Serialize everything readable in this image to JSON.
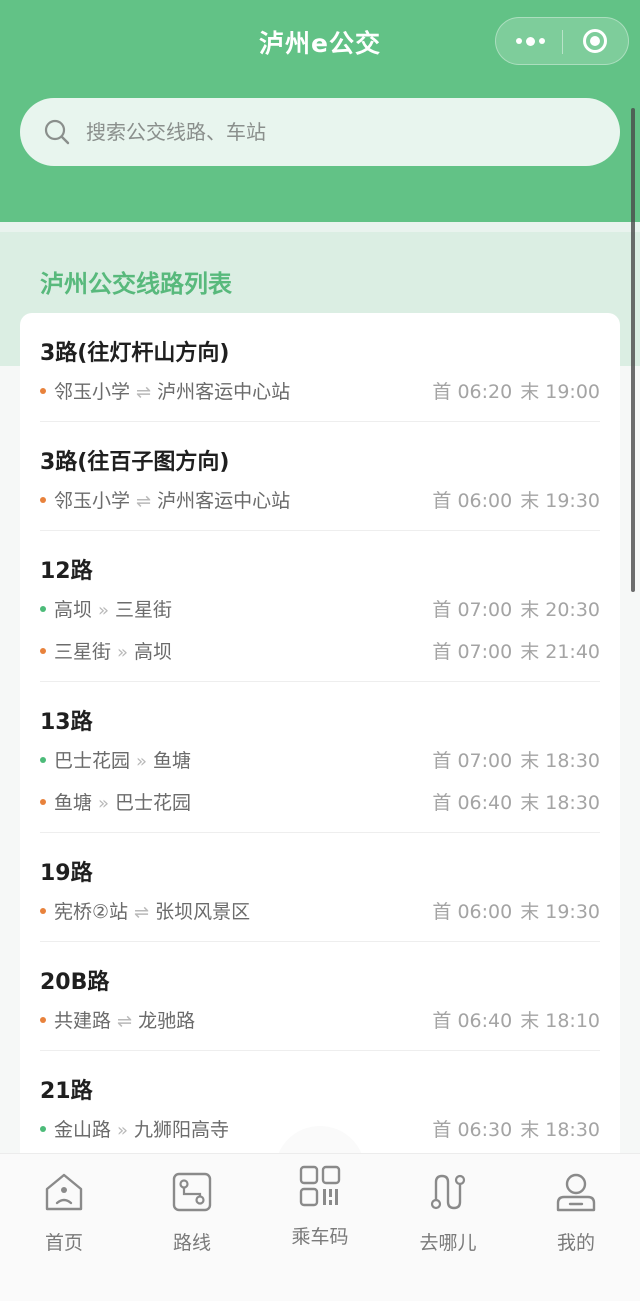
{
  "header": {
    "title": "泸州e公交",
    "icons": {
      "more": "more-dots-icon",
      "close": "target-circle-icon"
    }
  },
  "search": {
    "placeholder": "搜索公交线路、车站",
    "icon": "search-icon"
  },
  "section": {
    "title": "泸州公交线路列表"
  },
  "routes": [
    {
      "name": "3路(往灯杆山方向)",
      "directions": [
        {
          "dot": "orange",
          "from": "邻玉小学",
          "arrow": "⇌",
          "to": "泸州客运中心站",
          "first": "首 06:20",
          "last": "末 19:00"
        }
      ]
    },
    {
      "name": "3路(往百子图方向)",
      "directions": [
        {
          "dot": "orange",
          "from": "邻玉小学",
          "arrow": "⇌",
          "to": "泸州客运中心站",
          "first": "首 06:00",
          "last": "末 19:30"
        }
      ]
    },
    {
      "name": "12路",
      "directions": [
        {
          "dot": "green",
          "from": "高坝",
          "arrow": "»",
          "to": "三星街",
          "first": "首 07:00",
          "last": "末 20:30"
        },
        {
          "dot": "orange",
          "from": "三星街",
          "arrow": "»",
          "to": "高坝",
          "first": "首 07:00",
          "last": "末 21:40"
        }
      ]
    },
    {
      "name": "13路",
      "directions": [
        {
          "dot": "green",
          "from": "巴士花园",
          "arrow": "»",
          "to": "鱼塘",
          "first": "首 07:00",
          "last": "末 18:30"
        },
        {
          "dot": "orange",
          "from": "鱼塘",
          "arrow": "»",
          "to": "巴士花园",
          "first": "首 06:40",
          "last": "末 18:30"
        }
      ]
    },
    {
      "name": "19路",
      "directions": [
        {
          "dot": "orange",
          "from": "宪桥②站",
          "arrow": "⇌",
          "to": "张坝风景区",
          "first": "首 06:00",
          "last": "末 19:30"
        }
      ]
    },
    {
      "name": "20B路",
      "directions": [
        {
          "dot": "orange",
          "from": "共建路",
          "arrow": "⇌",
          "to": "龙驰路",
          "first": "首 06:40",
          "last": "末 18:10"
        }
      ]
    },
    {
      "name": "21路",
      "directions": [
        {
          "dot": "green",
          "from": "金山路",
          "arrow": "»",
          "to": "九狮阳高寺",
          "first": "首 06:30",
          "last": "末 18:30"
        }
      ]
    }
  ],
  "tabbar": [
    {
      "label": "首页",
      "icon": "home-icon"
    },
    {
      "label": "路线",
      "icon": "route-map-icon"
    },
    {
      "label": "乘车码",
      "icon": "qr-code-icon"
    },
    {
      "label": "去哪儿",
      "icon": "path-pin-icon"
    },
    {
      "label": "我的",
      "icon": "user-icon"
    }
  ],
  "colors": {
    "brand": "#62c286",
    "section_title": "#58b97c",
    "dot_orange": "#e8823c",
    "dot_green": "#4cbb79",
    "tab_gray": "#7a7a7a"
  }
}
